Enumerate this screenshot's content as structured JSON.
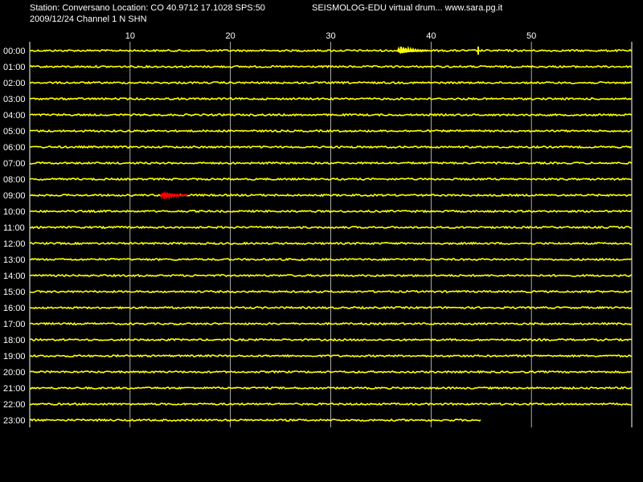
{
  "header": {
    "station_line": "Station: Conversano Location: CO 40.9712 17.1028 SPS:50",
    "date_line": "2009/12/24  Channel 1 N SHN",
    "brand": "SEISMOLOG-EDU virtual drum... www.sara.pg.it"
  },
  "colors": {
    "background": "#000000",
    "trace": "#ffff00",
    "event": "#ff0000",
    "grid": "#ffffff"
  },
  "chart_data": {
    "type": "line",
    "title": "",
    "xlabel": "",
    "ylabel": "",
    "x_ticks": [
      10,
      20,
      30,
      40,
      50
    ],
    "xlim": [
      0,
      60
    ],
    "grid": true,
    "rows": [
      "00:00",
      "01:00",
      "02:00",
      "03:00",
      "04:00",
      "05:00",
      "06:00",
      "07:00",
      "08:00",
      "09:00",
      "10:00",
      "11:00",
      "12:00",
      "13:00",
      "14:00",
      "15:00",
      "16:00",
      "17:00",
      "18:00",
      "19:00",
      "20:00",
      "21:00",
      "22:00",
      "23:00"
    ],
    "last_row_end_minute": 45,
    "events": [
      {
        "row": "00:00",
        "start_minute": 36.6,
        "end_minute": 39.8,
        "color": "yellow"
      },
      {
        "row": "00:00",
        "start_minute": 44.7,
        "end_minute": 44.9,
        "color": "yellow"
      },
      {
        "row": "09:00",
        "start_minute": 13.0,
        "end_minute": 15.8,
        "color": "red"
      }
    ]
  }
}
